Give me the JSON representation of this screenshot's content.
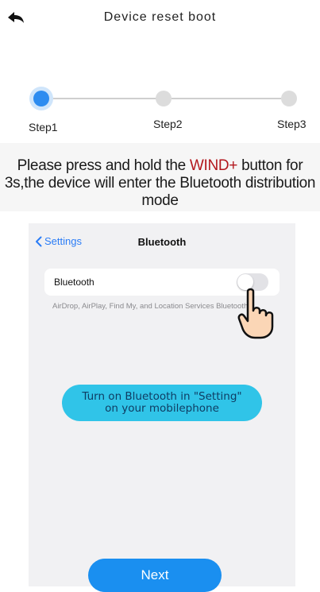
{
  "header": {
    "title": "Device reset boot",
    "back_icon": "back-arrow-icon"
  },
  "steps": {
    "items": [
      {
        "label": "Step1",
        "active": true
      },
      {
        "label": "Step2",
        "active": false
      },
      {
        "label": "Step3",
        "active": false
      }
    ],
    "active_color": "#2d8cf0",
    "inactive_color": "#dcdcdc"
  },
  "instruction": {
    "prefix": "Please press and hold the ",
    "highlight": "WIND+",
    "suffix": " button for 3s,the device will enter the Bluetooth distribution mode",
    "highlight_color": "#b3171d"
  },
  "phone": {
    "back_label": "Settings",
    "title": "Bluetooth",
    "row_label": "Bluetooth",
    "toggle_on": false,
    "note": "AirDrop, AirPlay, Find My, and Location Services  Bluetooth.",
    "bubble_line1": "Turn on Bluetooth in \"Setting\"",
    "bubble_line2": "on your mobilephone",
    "accent_color": "#2a7cf6"
  },
  "footer": {
    "next_label": "Next"
  }
}
